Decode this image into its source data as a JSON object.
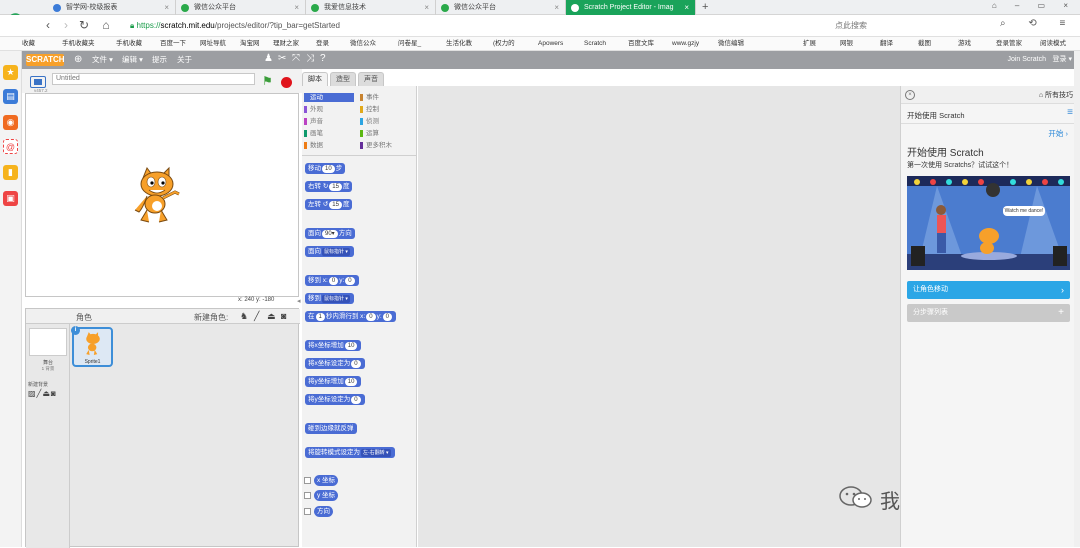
{
  "browser": {
    "tabs": [
      {
        "label": "智学网-校级报表"
      },
      {
        "label": "微信公众平台"
      },
      {
        "label": "我爱信息技术"
      },
      {
        "label": "微信公众平台"
      },
      {
        "label": "Scratch Project Editor - Imag"
      }
    ],
    "new_tab": "+",
    "url_prefix": "https://",
    "url_host": "scratch.mit.edu",
    "url_path": "/projects/editor/?tip_bar=getStarted",
    "search_placeholder": "点此搜索",
    "favorites": [
      "收藏",
      "手机收藏夹",
      "手机收藏",
      "百度一下",
      "网址导航",
      "淘宝网",
      "理财之家",
      "登录",
      "微信公众",
      "问卷星_",
      "生活化教",
      "(权力的",
      "Apowers",
      "Scratch",
      "百度文库",
      "www.gzjy",
      "微信编辑",
      "扩展",
      "网银",
      "翻译",
      "截图",
      "游戏",
      "登录管家",
      "阅读模式"
    ]
  },
  "scratch": {
    "logo": "SCRATCH",
    "menus": [
      "文件",
      "编辑",
      "提示",
      "关于"
    ],
    "join": "Join Scratch",
    "signin": "登录",
    "version": "v457.2",
    "project_title": "Untitled",
    "coords": "x: 240  y: -180",
    "sprites_label": "角色",
    "new_sprite_label": "新建角色:",
    "stage_label": "舞台",
    "stage_bg_count": "1 背景",
    "new_backdrop_label": "新建背景",
    "sprite1_name": "Sprite1",
    "tabs": [
      "脚本",
      "造型",
      "声音"
    ],
    "categories_left": [
      "运动",
      "外观",
      "声音",
      "画笔",
      "数据"
    ],
    "categories_right": [
      "事件",
      "控制",
      "侦测",
      "运算",
      "更多积木"
    ],
    "blocks": {
      "move": {
        "a": "移动",
        "n": "10",
        "b": "步"
      },
      "turn_right": {
        "a": "右转",
        "n": "15",
        "b": "度"
      },
      "turn_left": {
        "a": "左转",
        "n": "15",
        "b": "度"
      },
      "point_dir": {
        "a": "面向",
        "n": "90▾",
        "b": "方向"
      },
      "point_towards": {
        "a": "面向",
        "d": "鼠标指针 ▾"
      },
      "goto_xy": {
        "a": "移到 x:",
        "n1": "0",
        "m": "y:",
        "n2": "0"
      },
      "goto": {
        "a": "移到",
        "d": "鼠标指针 ▾"
      },
      "glide": {
        "a": "在",
        "n": "1",
        "b": "秒内滑行到 x:",
        "n1": "0",
        "m": "y:",
        "n2": "0"
      },
      "change_x": {
        "a": "将x坐标增加",
        "n": "10"
      },
      "set_x": {
        "a": "将x坐标设定为",
        "n": "0"
      },
      "change_y": {
        "a": "将y坐标增加",
        "n": "10"
      },
      "set_y": {
        "a": "将y坐标设定为",
        "n": "0"
      },
      "bounce": {
        "a": "碰到边缘就反弹"
      },
      "rotation": {
        "a": "将旋转模式设定为",
        "d": "左-右翻转 ▾"
      },
      "rep_x": "x 坐标",
      "rep_y": "y 坐标",
      "rep_dir": "方向"
    }
  },
  "tips": {
    "all_tips": "所有技巧",
    "header": "开始使用 Scratch",
    "start": "开始",
    "title": "开始使用 Scratch",
    "subtitle": "第一次使用 Scratchs？试试这个！",
    "speech": "Watch me dance!",
    "btn_move": "让角色移动",
    "btn_steps": "分步骤列表"
  },
  "watermark": "我爱信息技术",
  "colors": {
    "motion": "#4a6cd4",
    "looks": "#8a55d7",
    "sound": "#bb42c3",
    "pen": "#0e9a6c",
    "data": "#ee7d16",
    "events": "#c88330",
    "control": "#e1a91a",
    "sensing": "#2ca5e2",
    "operators": "#5cb712",
    "more": "#632d99",
    "accent": "#2ba6e6"
  }
}
